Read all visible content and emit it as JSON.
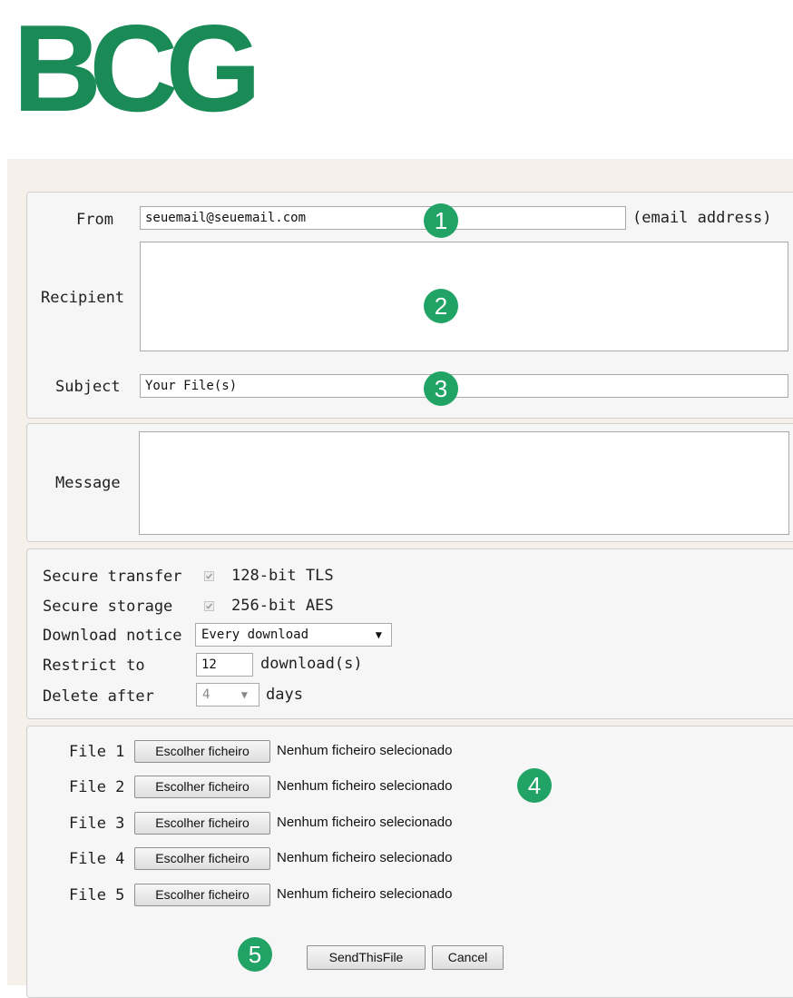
{
  "brand": {
    "logo_text": "BCG",
    "color": "#1a8a57"
  },
  "form": {
    "from_label": "From",
    "from_value": "seuemail@seuemail.com",
    "from_hint": "(email address)",
    "recipient_label": "Recipient",
    "recipient_value": "",
    "subject_label": "Subject",
    "subject_value": "Your File(s)",
    "message_label": "Message",
    "message_value": ""
  },
  "options": {
    "secure_transfer_label": "Secure transfer",
    "secure_transfer_value": "128-bit TLS",
    "secure_storage_label": "Secure storage",
    "secure_storage_value": "256-bit AES",
    "download_notice_label": "Download notice",
    "download_notice_selected": "Every download",
    "restrict_label": "Restrict to",
    "restrict_value": "12",
    "restrict_unit": "download(s)",
    "delete_label": "Delete after",
    "delete_value": "4",
    "delete_unit": "days"
  },
  "files": [
    {
      "label": "File 1",
      "button": "Escolher ficheiro",
      "status": "Nenhum ficheiro selecionado"
    },
    {
      "label": "File 2",
      "button": "Escolher ficheiro",
      "status": "Nenhum ficheiro selecionado"
    },
    {
      "label": "File 3",
      "button": "Escolher ficheiro",
      "status": "Nenhum ficheiro selecionado"
    },
    {
      "label": "File 4",
      "button": "Escolher ficheiro",
      "status": "Nenhum ficheiro selecionado"
    },
    {
      "label": "File 5",
      "button": "Escolher ficheiro",
      "status": "Nenhum ficheiro selecionado"
    }
  ],
  "actions": {
    "send_label": "SendThisFile",
    "cancel_label": "Cancel"
  },
  "annotations": {
    "badge_1": "1",
    "badge_2": "2",
    "badge_3": "3",
    "badge_4": "4",
    "badge_5": "5",
    "color": "#21a366"
  }
}
